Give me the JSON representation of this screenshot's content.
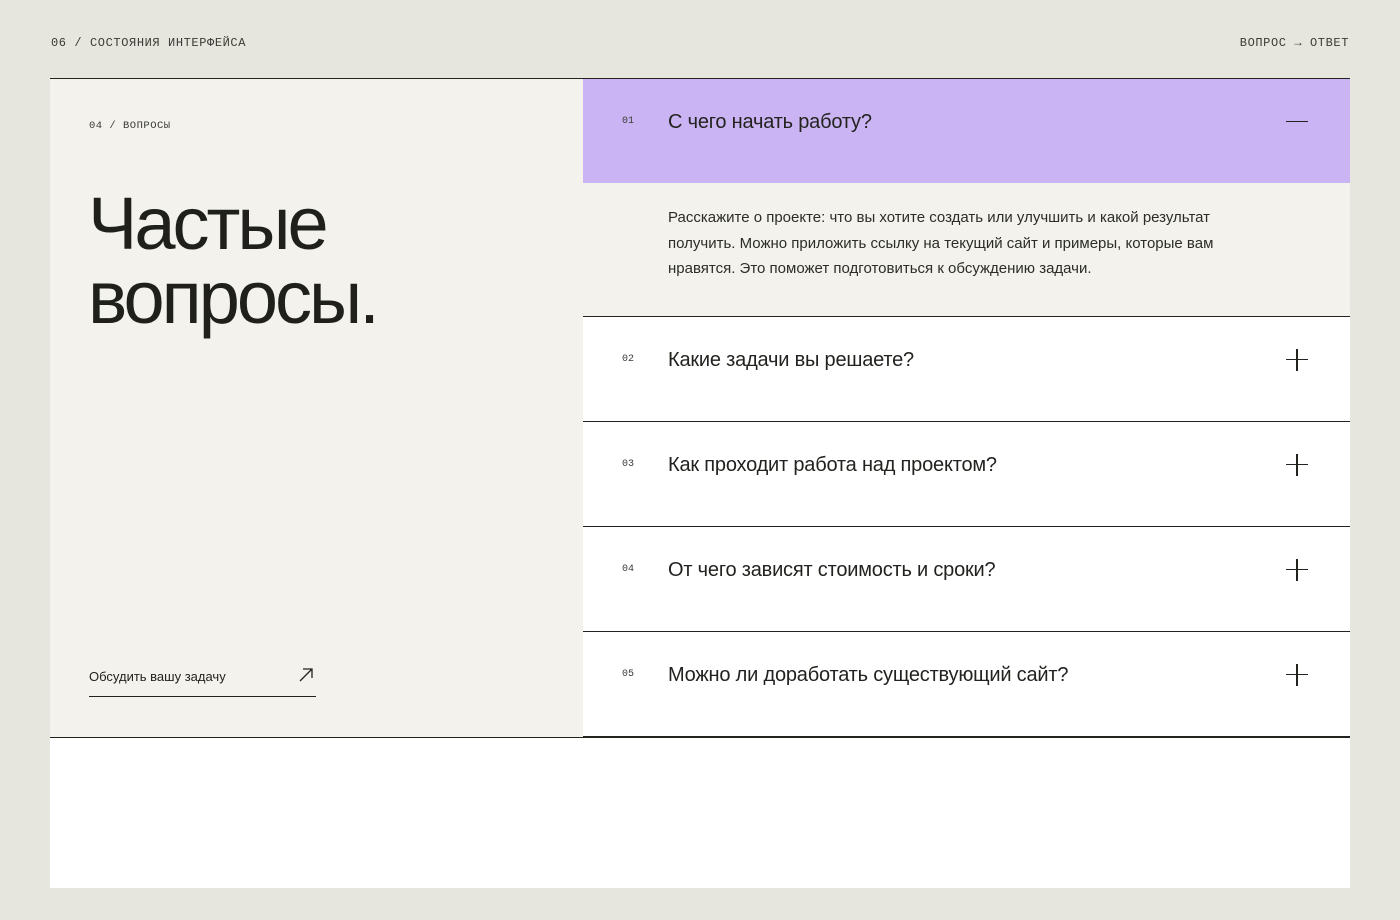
{
  "header": {
    "left_label": "06 / СОСТОЯНИЯ ИНТЕРФЕЙСА",
    "right_label": "ВОПРОС → ОТВЕТ"
  },
  "left": {
    "section_label": "04 / ВОПРОСЫ",
    "title_line1": "Частые",
    "title_line2": "вопросы.",
    "cta_label": "Обсудить вашу задачу",
    "cta_icon": "arrow-up-right-icon"
  },
  "faq": {
    "items": [
      {
        "num": "01",
        "question": "С чего начать работу?",
        "open": true,
        "answer": "Расскажите о проекте: что вы хотите создать или улучшить и какой результат получить. Можно приложить ссылку на текущий сайт и примеры, которые вам нравятся. Это поможет подготовиться к обсуждению задачи."
      },
      {
        "num": "02",
        "question": "Какие задачи вы решаете?",
        "open": false
      },
      {
        "num": "03",
        "question": "Как проходит работа над проектом?",
        "open": false
      },
      {
        "num": "04",
        "question": "От чего зависят стоимость и сроки?",
        "open": false
      },
      {
        "num": "05",
        "question": "Можно ли доработать существующий сайт?",
        "open": false
      }
    ]
  },
  "colors": {
    "background": "#e6e5de",
    "panel": "#f3f2ec",
    "accent_open": "#cbb4f3",
    "ink": "#22231f"
  }
}
